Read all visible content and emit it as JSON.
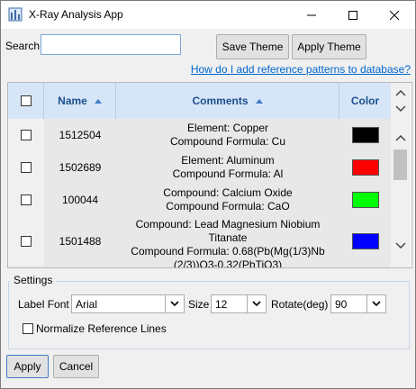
{
  "window": {
    "title": "X-Ray Analysis App",
    "app_icon": "app-icon",
    "controls": [
      "minimize-icon",
      "maximize-icon",
      "close-icon"
    ]
  },
  "search": {
    "label": "Search",
    "value": "",
    "placeholder": ""
  },
  "toolbar": {
    "save_theme_label": "Save Theme",
    "apply_theme_label": "Apply Theme"
  },
  "help_link": "How do I add reference patterns to database?",
  "table": {
    "columns": {
      "name": "Name",
      "comments": "Comments",
      "color": "Color"
    },
    "sort": {
      "name": "ascending",
      "comments": "ascending"
    },
    "rows": [
      {
        "name": "1512504",
        "comments": [
          "Element: Copper",
          "Compound Formula: Cu"
        ],
        "color": "#000000",
        "checked": false
      },
      {
        "name": "1502689",
        "comments": [
          "Element: Aluminum",
          "Compound Formula: Al"
        ],
        "color": "#ff0000",
        "checked": false
      },
      {
        "name": "100044",
        "comments": [
          "Compound: Calcium Oxide",
          "Compound Formula: CaO"
        ],
        "color": "#00ff00",
        "checked": false
      },
      {
        "name": "1501488",
        "comments": [
          "Compound: Lead Magnesium Niobium",
          "Titanate",
          "Compound Formula: 0.68(Pb(Mg(1/3)Nb",
          "(2/3))O3-0.32(PbTiO3)"
        ],
        "color": "#0000ff",
        "checked": false
      }
    ]
  },
  "settings": {
    "legend": "Settings",
    "label_font_label": "Label Font",
    "label_font_value": "Arial",
    "size_label": "Size",
    "size_value": "12",
    "rotate_label": "Rotate(deg)",
    "rotate_value": "90",
    "normalize_label": "Normalize Reference Lines",
    "normalize_checked": false
  },
  "footer": {
    "apply_label": "Apply",
    "cancel_label": "Cancel"
  }
}
